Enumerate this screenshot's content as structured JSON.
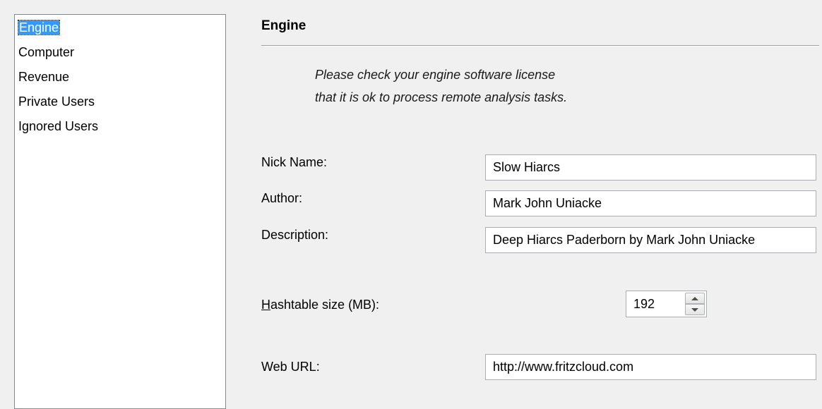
{
  "nav": {
    "items": [
      {
        "label": "Engine",
        "selected": true
      },
      {
        "label": "Computer",
        "selected": false
      },
      {
        "label": "Revenue",
        "selected": false
      },
      {
        "label": "Private Users",
        "selected": false
      },
      {
        "label": "Ignored Users",
        "selected": false
      }
    ]
  },
  "section": {
    "title": "Engine",
    "notice_line1": "Please check your engine software license",
    "notice_line2": "that it is ok to process remote analysis tasks."
  },
  "form": {
    "nick_name": {
      "label": "Nick Name:",
      "value": "Slow Hiarcs"
    },
    "author": {
      "label": "Author:",
      "value": "Mark John Uniacke"
    },
    "description": {
      "label": "Description:",
      "value": "Deep Hiarcs Paderborn by Mark John Uniacke"
    },
    "hashtable": {
      "label_accel": "H",
      "label_rest": "ashtable size (MB):",
      "value": "192"
    },
    "web_url": {
      "label": "Web URL:",
      "value": "http://www.fritzcloud.com"
    }
  },
  "icons": {
    "spin_up": "spin-up-arrow-icon",
    "spin_down": "spin-down-arrow-icon"
  },
  "colors": {
    "selection": "#3399ff",
    "background": "#f0f0f0"
  }
}
